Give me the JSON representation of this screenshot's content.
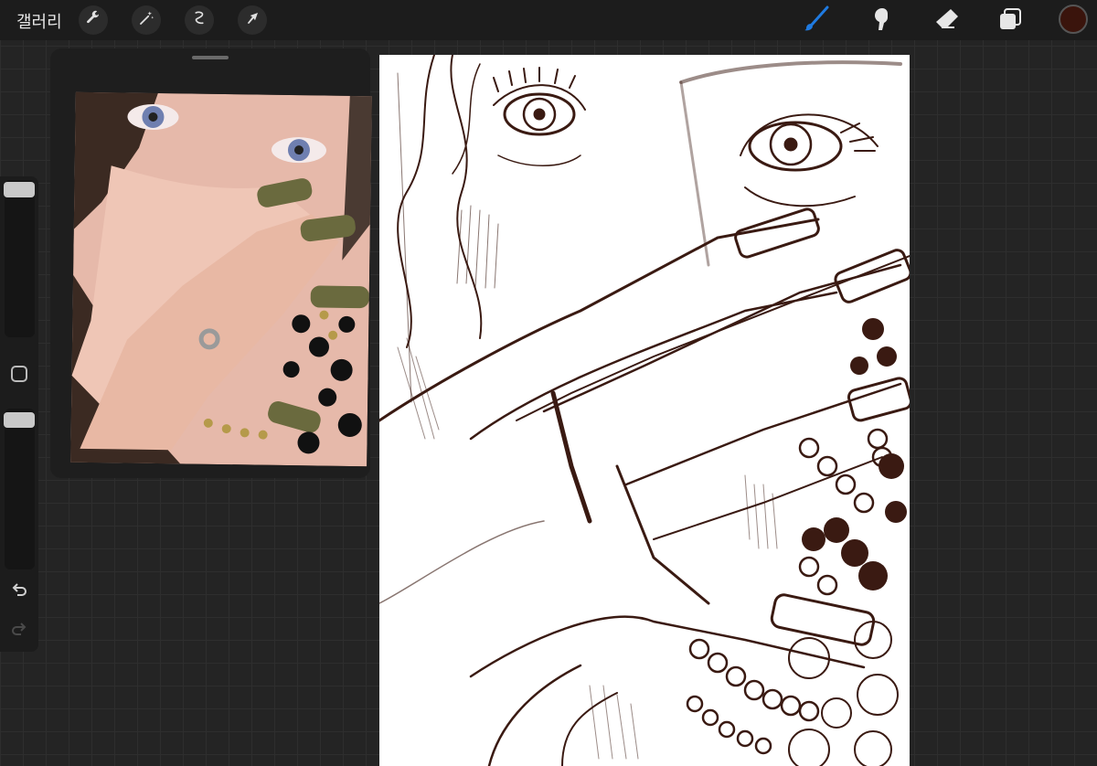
{
  "app": {
    "gallery_label": "갤러리"
  },
  "toolbar": {
    "left_icons": [
      "wrench-icon",
      "magic-wand-icon",
      "selection-icon",
      "move-arrow-icon"
    ],
    "right_icons": [
      "brush-icon",
      "smudge-icon",
      "eraser-icon",
      "layers-icon"
    ],
    "active_tool": "brush",
    "active_color": "#3a140c",
    "accent": "#1f7ae0"
  },
  "sidebar": {
    "brush_size_level": 0.03,
    "opacity_level": 0.03,
    "icons": [
      "modify-square-icon",
      "undo-icon",
      "redo-icon"
    ]
  },
  "reference": {
    "kind": "photo reference"
  }
}
